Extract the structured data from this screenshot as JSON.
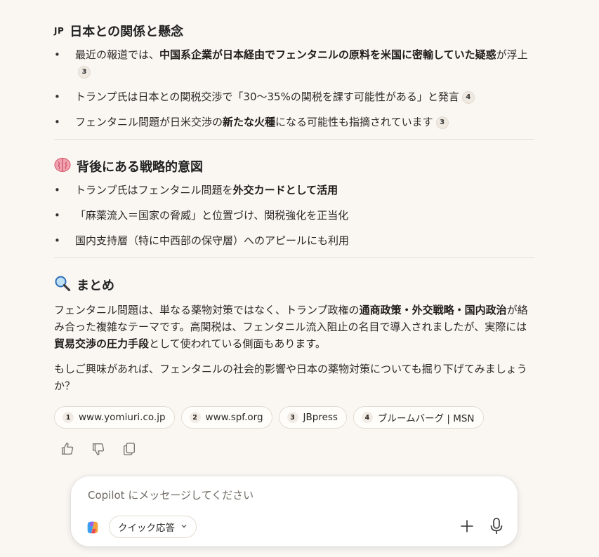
{
  "sections": [
    {
      "title": "日本との関係と懸念",
      "flag": "JP",
      "items": [
        {
          "segments": [
            {
              "t": "最近の報道では、",
              "b": false
            },
            {
              "t": "中国系企業が日本経由でフェンタニルの原料を米国に密輸していた疑惑",
              "b": true
            },
            {
              "t": "が浮上",
              "b": false
            }
          ],
          "cite": "3"
        },
        {
          "segments": [
            {
              "t": "トランプ氏は日本との関税交渉で「30～35%の関税を課す可能性がある」と発言",
              "b": false
            }
          ],
          "cite": "4"
        },
        {
          "segments": [
            {
              "t": "フェンタニル問題が日米交渉の",
              "b": false
            },
            {
              "t": "新たな火種",
              "b": true
            },
            {
              "t": "になる可能性も指摘されています",
              "b": false
            }
          ],
          "cite": "3"
        }
      ]
    },
    {
      "title": "背後にある戦略的意図",
      "icon": "brain-icon",
      "items": [
        {
          "segments": [
            {
              "t": "トランプ氏はフェンタニル問題を",
              "b": false
            },
            {
              "t": "外交カードとして活用",
              "b": true
            }
          ],
          "cite": ""
        },
        {
          "segments": [
            {
              "t": "「麻薬流入＝国家の脅威」と位置づけ、関税強化を正当化",
              "b": false
            }
          ],
          "cite": ""
        },
        {
          "segments": [
            {
              "t": "国内支持層（特に中西部の保守層）へのアピールにも利用",
              "b": false
            }
          ],
          "cite": ""
        }
      ]
    }
  ],
  "summary": {
    "title": "まとめ",
    "icon": "magnifier-icon",
    "p1_a": "フェンタニル問題は、単なる薬物対策ではなく、トランプ政権の",
    "p1_b": "通商政策・外交戦略・国内政治",
    "p1_c": "が絡み合った複雑なテーマです。高関税は、フェンタニル流入阻止の名目で導入されましたが、実際には",
    "p1_d": "貿易交渉の圧力手段",
    "p1_e": "として使われている側面もあります。",
    "p2": "もしご興味があれば、フェンタニルの社会的影響や日本の薬物対策についても掘り下げてみましょうか？"
  },
  "sources": [
    {
      "num": "1",
      "label": "www.yomiuri.co.jp"
    },
    {
      "num": "2",
      "label": "www.spf.org"
    },
    {
      "num": "3",
      "label": "JBpress"
    },
    {
      "num": "4",
      "label": "ブルームバーグ | MSN"
    }
  ],
  "composer": {
    "placeholder": "Copilot にメッセージしてください",
    "mode_label": "クイック応答"
  },
  "colors": {
    "background": "#faf7f3",
    "text": "#2b2926",
    "brain": "#e57c8c",
    "magnifier": "#3b7dd8"
  }
}
